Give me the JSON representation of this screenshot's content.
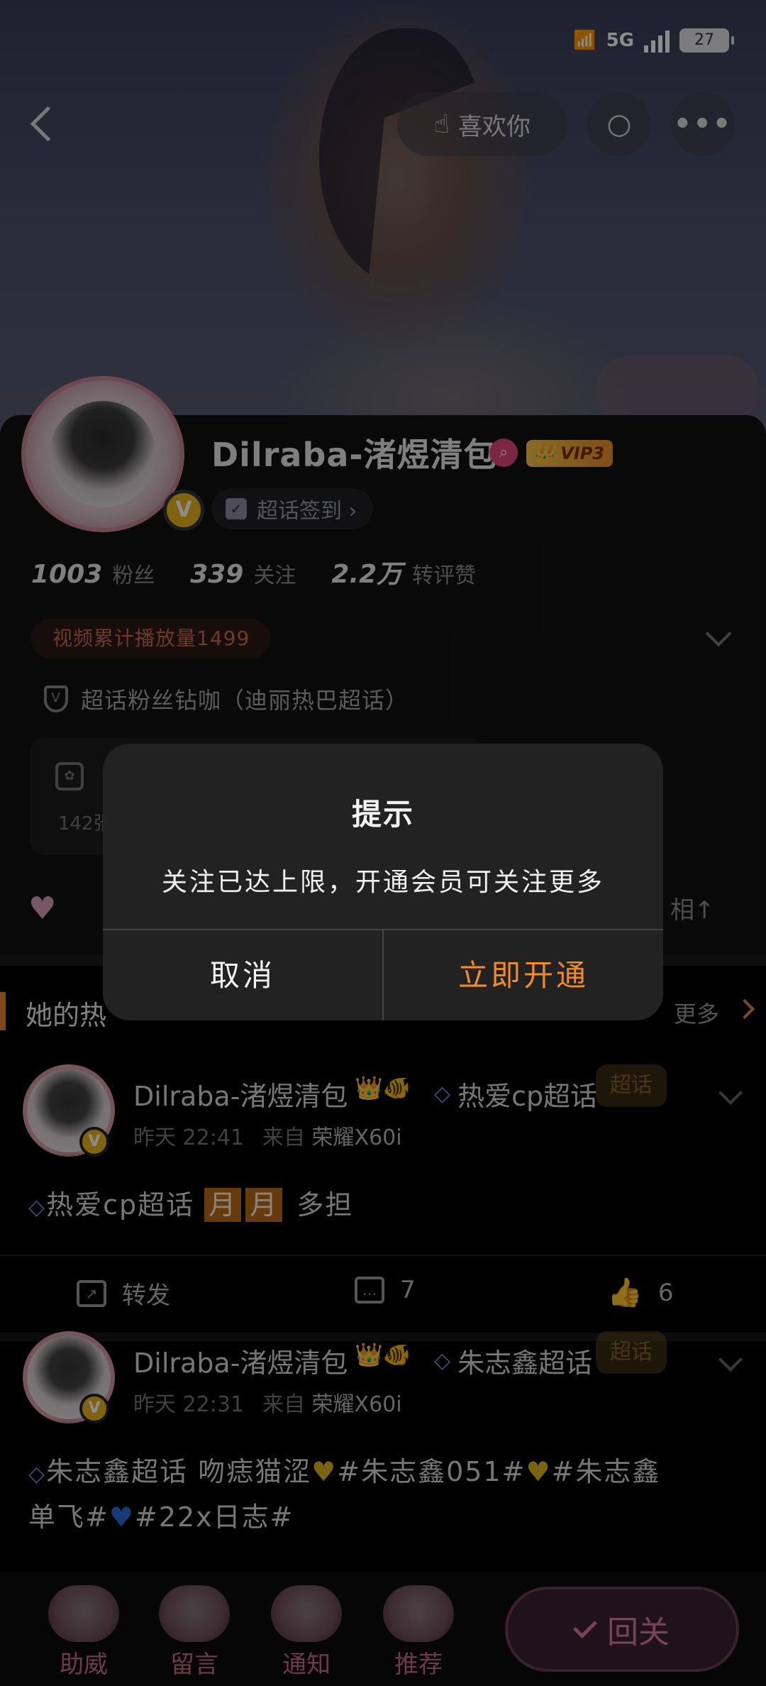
{
  "status_bar": {
    "wifi": "⁶ᵂ",
    "network": "5G",
    "battery": "27"
  },
  "nav": {
    "like_label": "喜欢你"
  },
  "profile": {
    "username": "Dilraba-渚煜清包",
    "vip": "VIP3",
    "checkin": "超话签到 ›",
    "stats": [
      {
        "num": "1003",
        "label": "粉丝"
      },
      {
        "num": "339",
        "label": "关注"
      },
      {
        "num": "2.2万",
        "label": "转评赞"
      }
    ],
    "play_count": "视频累计播放量1499",
    "fan_title": "超话粉丝钻咖（迪丽热巴超话）",
    "album_count": "142张",
    "relation": "相↑"
  },
  "hot": {
    "title": "她的热",
    "more": "更多"
  },
  "posts": [
    {
      "author": "Dilraba-渚煜清包",
      "badges": "👑🐠",
      "topic": "热爱cp超话",
      "sticker": "超话",
      "time": "昨天 22:41",
      "from": "来自",
      "device": "荣耀X60i",
      "content_lead": "热爱cp超话",
      "tag1": "月",
      "tag2": "月",
      "content_tail": "多担",
      "repost": "转发",
      "comments": "7",
      "likes": "6"
    },
    {
      "author": "Dilraba-渚煜清包",
      "badges": "👑🐠",
      "topic": "朱志鑫超话",
      "sticker": "超话",
      "time": "昨天 22:31",
      "from": "来自",
      "device": "荣耀X60i",
      "content_1": "朱志鑫超话 吻痣猫涩",
      "content_2": "#朱志鑫051#",
      "content_3": "#朱志鑫",
      "content_4": "单飞#",
      "content_5": "#22x日志#"
    }
  ],
  "bottom_tabs": [
    "助威",
    "留言",
    "通知",
    "推荐"
  ],
  "follow_button": "回关",
  "dialog": {
    "title": "提示",
    "message": "关注已达上限，开通会员可关注更多",
    "cancel": "取消",
    "confirm": "立即开通"
  },
  "colors": {
    "accent": "#f08a2c",
    "background": "#000000",
    "dialog": "#222222",
    "vip_gold": "#e8b420"
  }
}
